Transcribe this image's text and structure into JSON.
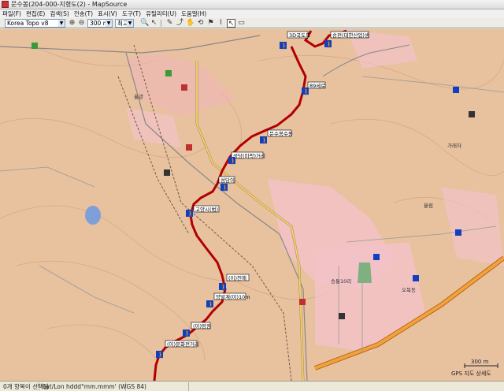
{
  "window": {
    "title": "문수봉(204-000-지형도(2) - MapSource"
  },
  "menu": {
    "items": [
      "파일(F)",
      "편집(E)",
      "검색(S)",
      "전송(T)",
      "표시(V)",
      "도구(T)",
      "유틸리티(U)",
      "도움말(H)"
    ]
  },
  "toolbar": {
    "map_product": "Korea Topo v8",
    "zoom_value": "300 m",
    "detail_value": "최고"
  },
  "map": {
    "waypoints": [
      {
        "label": "3D국도도"
      },
      {
        "label": "송전(대한산업)생"
      },
      {
        "label": "89세로"
      },
      {
        "label": "문수봉수동"
      },
      {
        "label": "성당(미락)거리"
      },
      {
        "label": "성당이"
      },
      {
        "label": "고양시(법)"
      },
      {
        "label": "(이)천해"
      },
      {
        "label": "양발계(이)10m"
      },
      {
        "label": "(이)망점"
      },
      {
        "label": "(이)문화전거리"
      }
    ],
    "place_labels": [
      "가래자",
      "율림",
      "율관",
      "오목동",
      "송통10리"
    ],
    "scale_label": "300 m",
    "copyright": "GPS 지도 상세도"
  },
  "status": {
    "selection": "0개 항목이 선택됨",
    "coord_format": "Lat/Lon hddd°mm.mmm' (WGS 84)"
  }
}
